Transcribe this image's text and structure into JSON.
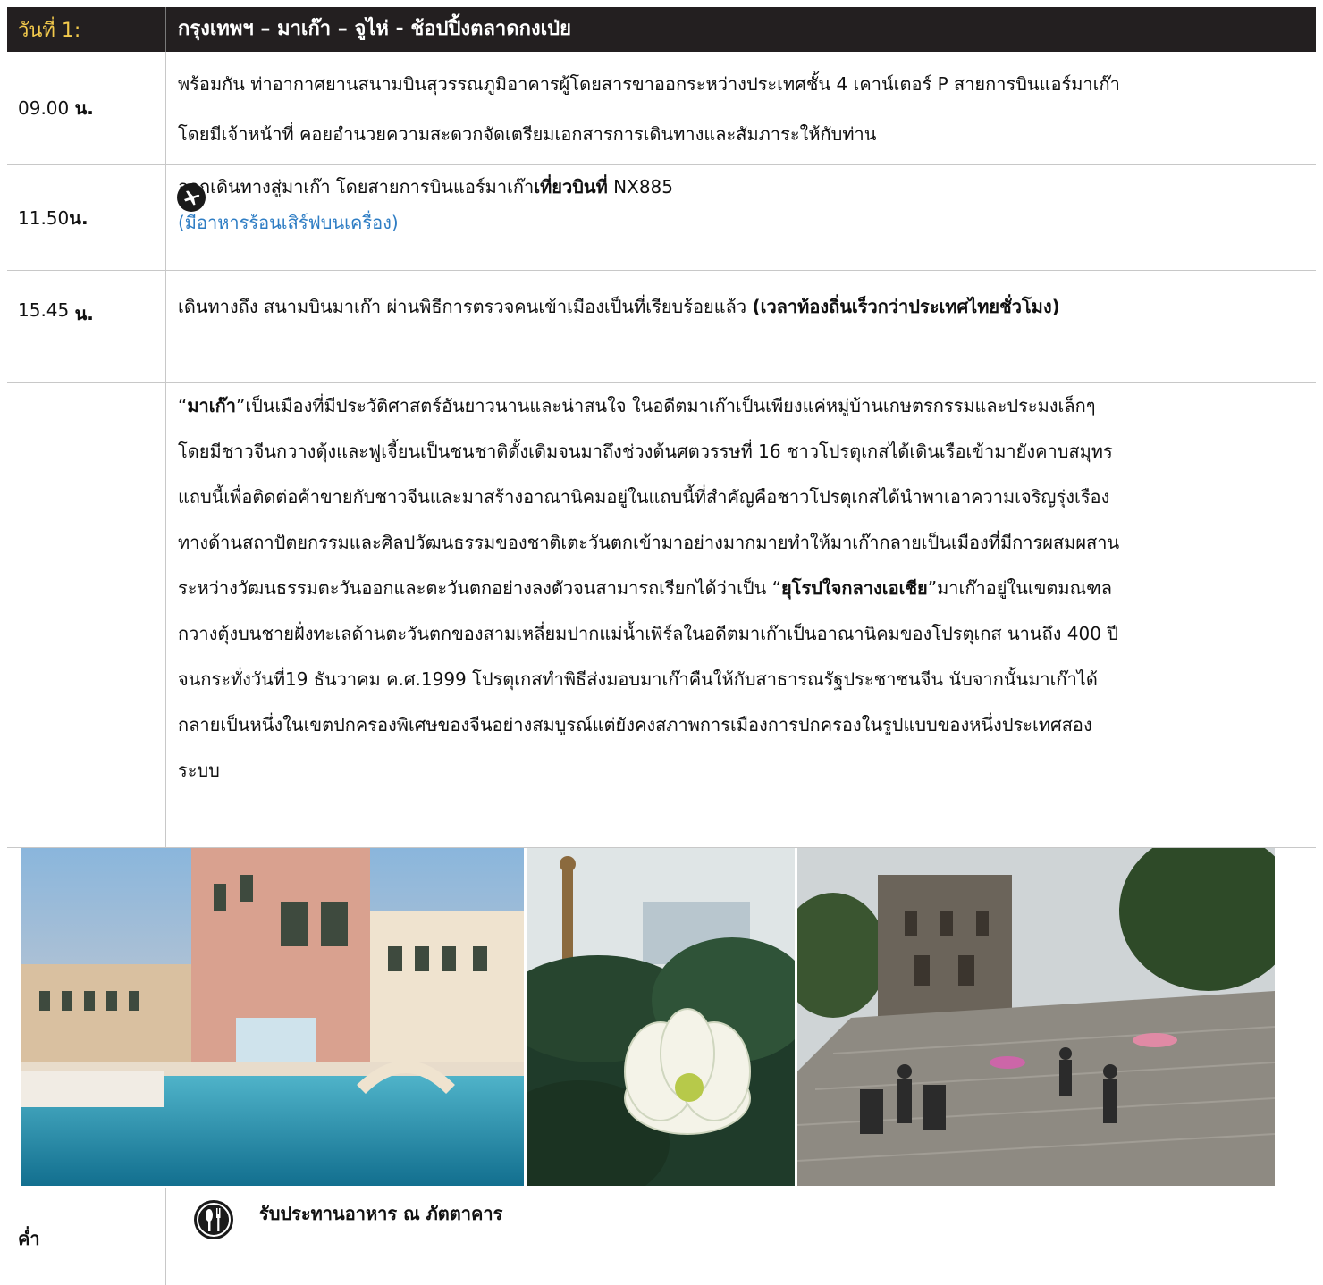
{
  "header": {
    "day_label": "วันที่ 1:",
    "title": "กรุงเทพฯ – มาเก๊า – จูไห่ - ช้อปปิ้งตลาดกงเป่ย"
  },
  "rows": [
    {
      "time_num": "09.00",
      "time_unit": "น.",
      "line1": "พร้อมกัน ท่าอากาศยานสนามบินสุวรรณภูมิอาคารผู้โดยสารขาออกระหว่างประเทศชั้น 4 เคาน์เตอร์ P สายการบินแอร์มาเก๊า",
      "line2": "โดยมีเจ้าหน้าที่ คอยอำนวยความสะดวกจัดเตรียมเอกสารการเดินทางและสัมภาระให้กับท่าน"
    },
    {
      "time_num": "11.50",
      "time_unit": "น.",
      "line1_pre": "ออกเดินทางสู่มาเก๊า  โดยสายการบินแอร์มาเก๊า",
      "line1_bold": "เที่ยวบินที่",
      "line1_post": " NX885",
      "line2": "(มีอาหารร้อนเสิร์ฟบนเครื่อง)"
    },
    {
      "time_num": "15.45",
      "time_unit": "น.",
      "line1_pre": "เดินทางถึง สนามบินมาเก๊า  ผ่านพิธีการตรวจคนเข้าเมืองเป็นที่เรียบร้อยแล้ว ",
      "line1_bold": "(เวลาท้องถิ่นเร็วกว่าประเทศไทยชั่วโมง)"
    }
  ],
  "intro": {
    "q_open": "“",
    "bold1": "มาเก๊า",
    "text1": "”เป็นเมืองที่มีประวัติศาสตร์อันยาวนานและน่าสนใจ ในอดีตมาเก๊าเป็นเพียงแค่หมู่บ้านเกษตรกรรมและประมงเล็กๆ",
    "l2": "โดยมีชาวจีนกวางตุ้งและฟูเจี้ยนเป็นชนชาติดั้งเดิมจนมาถึงช่วงต้นศตวรรษที่ 16 ชาวโปรตุเกสได้เดินเรือเข้ามายังคาบสมุทร",
    "l3": "แถบนี้เพื่อติดต่อค้าขายกับชาวจีนและมาสร้างอาณานิคมอยู่ในแถบนี้ที่สำคัญคือชาวโปรตุเกสได้นำพาเอาความเจริญรุ่งเรือง",
    "l4": "ทางด้านสถาปัตยกรรมและศิลปวัฒนธรรมของชาติเตะวันตกเข้ามาอย่างมากมายทำให้มาเก๊ากลายเป็นเมืองที่มีการผสมผสาน",
    "l5_pre": "ระหว่างวัฒนธรรมตะวันออกและตะวันตกอย่างลงตัวจนสามารถเรียกได้ว่าเป็น “",
    "l5_bold": "ยุโรปใจกลางเอเชีย",
    "l5_post": "”มาเก๊าอยู่ในเขตมณฑล",
    "l6": "กวางตุ้งบนชายฝั่งทะเลด้านตะวันตกของสามเหลี่ยมปากแม่น้ำเพิร์ลในอดีตมาเก๊าเป็นอาณานิคมของโปรตุเกส นานถึง 400 ปี",
    "l7": "จนกระทั่งวันที่19 ธันวาคม ค.ศ.1999 โปรตุเกสทำพิธีส่งมอบมาเก๊าคืนให้กับสาธารณรัฐประชาชนจีน นับจากนั้นมาเก๊าได้",
    "l8": "กลายเป็นหนึ่งในเขตปกครองพิเศษของจีนอย่างสมบูรณ์แต่ยังคงสภาพการเมืองการปกครองในรูปแบบของหนึ่งประเทศสอง",
    "l9": "ระบบ"
  },
  "dinner": {
    "time": "ค่ำ",
    "text": "รับประทานอาหาร ณ ภัตตาคาร"
  },
  "icons": {
    "plane": "airplane-icon",
    "meal": "fork-spoon-icon"
  }
}
